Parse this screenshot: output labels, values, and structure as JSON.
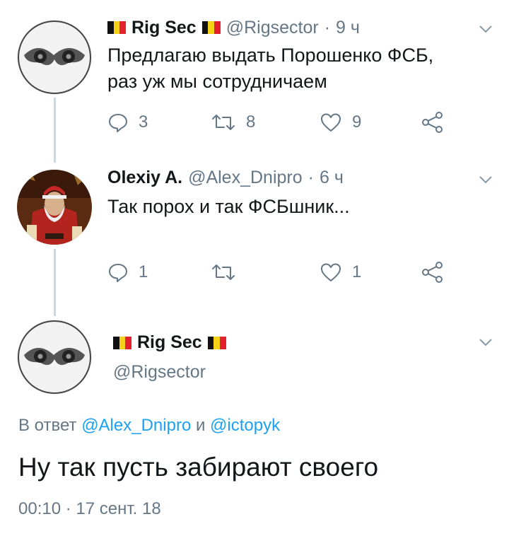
{
  "tweets": [
    {
      "name": "Rig Sec",
      "handle": "@Rigsector",
      "time": "9 ч",
      "text_line1": "Предлагаю выдать Порошенко ФСБ,",
      "text_line2": "раз уж мы сотрудничаем",
      "replies": "3",
      "retweets": "8",
      "likes": "9"
    },
    {
      "name": "Olexiy A.",
      "handle": "@Alex_Dnipro",
      "time": "6 ч",
      "text": "Так порох и так ФСБшник...",
      "replies": "1",
      "retweets": "",
      "likes": "1"
    }
  ],
  "main_tweet": {
    "name": "Rig Sec",
    "handle": "@Rigsector",
    "reply_prefix": "В ответ",
    "reply_user1": "@Alex_Dnipro",
    "reply_and": "и",
    "reply_user2": "@ictopyk",
    "text": "Ну так пусть забирают своего",
    "timestamp": "00:10 · 17 сент. 18"
  },
  "separator": "·",
  "colors": {
    "link": "#1da1f2",
    "secondary": "#657786",
    "thread_line": "#ccd6dd"
  }
}
